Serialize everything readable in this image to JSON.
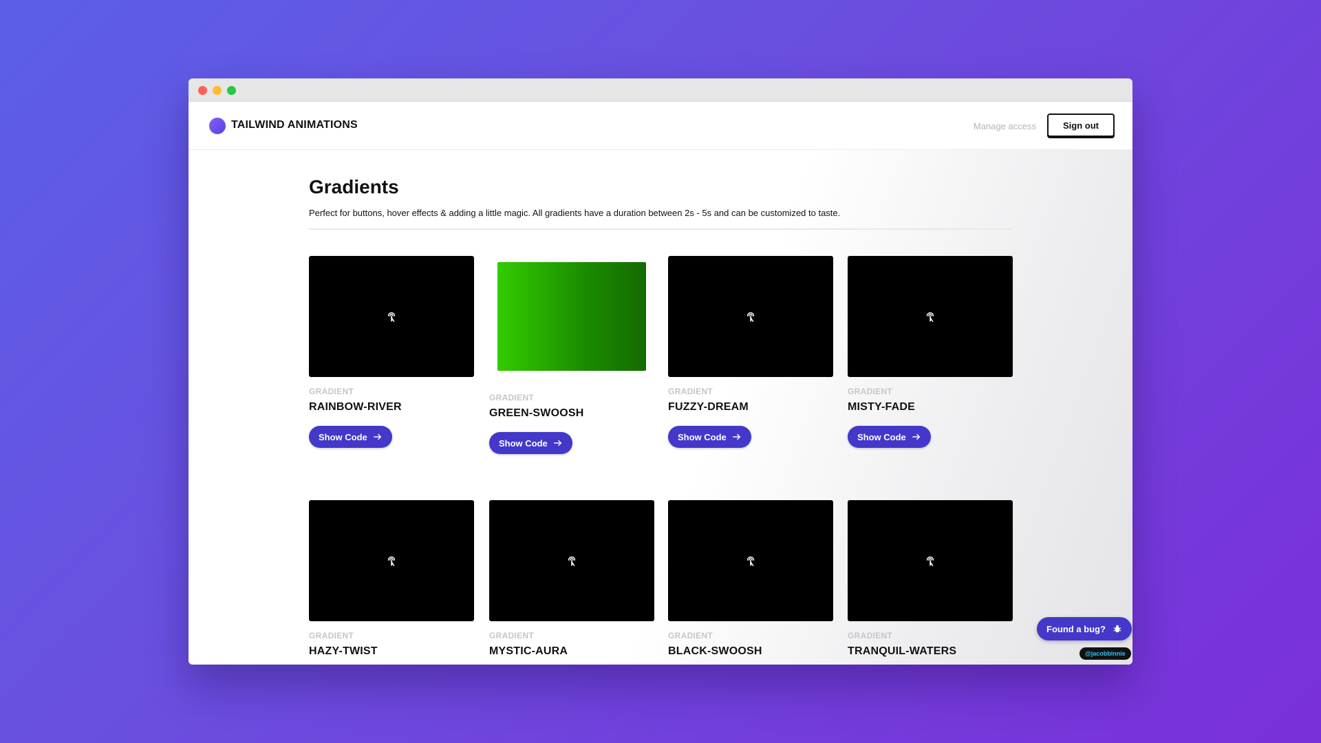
{
  "app": {
    "brand": "TAILWIND ANIMATIONS",
    "manage_access": "Manage access",
    "sign_out": "Sign out"
  },
  "page": {
    "title": "Gradients",
    "description": "Perfect for buttons, hover effects & adding a little magic. All gradients have a duration between 2s - 5s and can be customized to taste."
  },
  "cards": [
    {
      "kicker": "GRADIENT",
      "name": "RAINBOW-RIVER",
      "button": "Show Code"
    },
    {
      "kicker": "GRADIENT",
      "name": "GREEN-SWOOSH",
      "button": "Show Code"
    },
    {
      "kicker": "GRADIENT",
      "name": "FUZZY-DREAM",
      "button": "Show Code"
    },
    {
      "kicker": "GRADIENT",
      "name": "MISTY-FADE",
      "button": "Show Code"
    },
    {
      "kicker": "GRADIENT",
      "name": "HAZY-TWIST"
    },
    {
      "kicker": "GRADIENT",
      "name": "MYSTIC-AURA"
    },
    {
      "kicker": "GRADIENT",
      "name": "BLACK-SWOOSH"
    },
    {
      "kicker": "GRADIENT",
      "name": "TRANQUIL-WATERS"
    }
  ],
  "floating": {
    "bug_label": "Found a bug?",
    "credit": "@jacobbinnie"
  },
  "colors": {
    "accent": "#4338ca",
    "background_start": "#5b5fe8",
    "background_end": "#7a2fd8",
    "green_swoosh_start": "#33cc00",
    "green_swoosh_end": "#146b00"
  },
  "icons": {
    "preview": "tap-icon",
    "button": "arrow-right-icon",
    "bug": "bug-icon"
  }
}
